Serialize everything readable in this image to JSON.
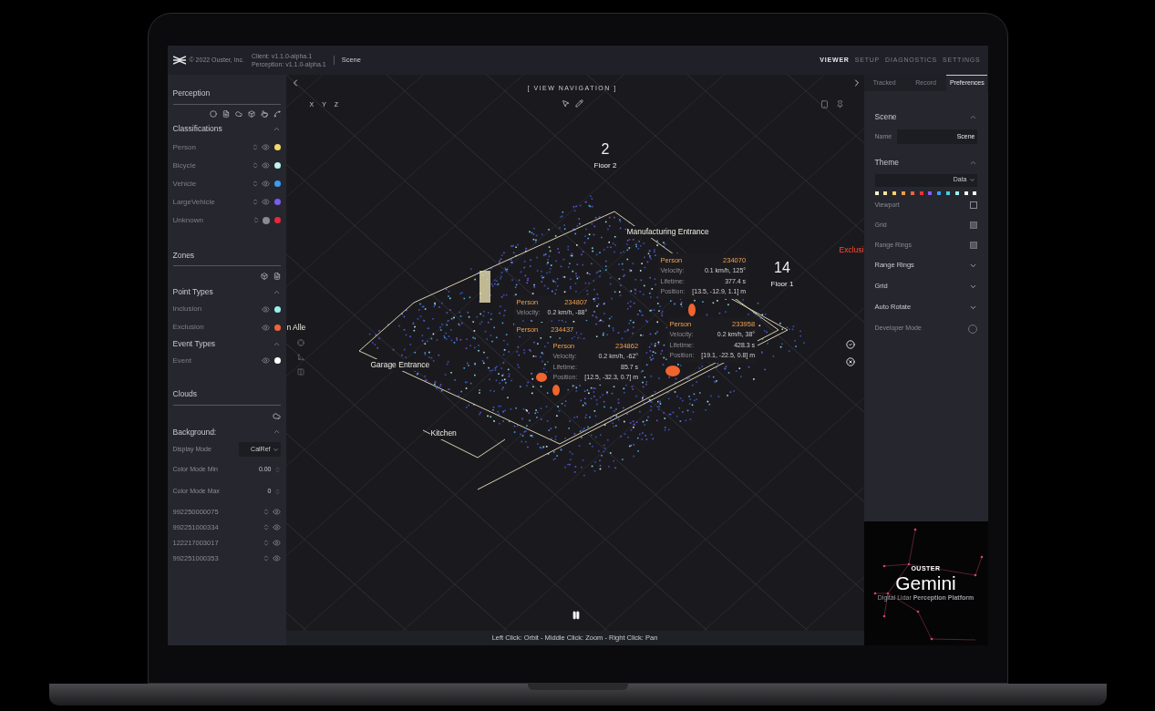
{
  "header": {
    "copyright": "© 2022 Ouster, Inc.",
    "versions": [
      "Client: v1.1.0-alpha.1",
      "Perception: v1.1.0-alpha.1"
    ],
    "page": "Scene",
    "nav": [
      {
        "label": "VIEWER",
        "selected": true
      },
      {
        "label": "SETUP",
        "selected": false
      },
      {
        "label": "DIAGNOSTICS",
        "selected": false
      },
      {
        "label": "SETTINGS",
        "selected": false
      }
    ]
  },
  "left_panel": {
    "perception": {
      "title": "Perception"
    },
    "classifications": {
      "title": "Classifications",
      "items": [
        {
          "label": "Person",
          "visible": true,
          "color": "#f5d76e"
        },
        {
          "label": "Bicycle",
          "visible": true,
          "color": "#bff5f0"
        },
        {
          "label": "Vehicle",
          "visible": true,
          "color": "#3b9cf0"
        },
        {
          "label": "LargeVehicle",
          "visible": true,
          "color": "#7a5cf0"
        },
        {
          "label": "Unknown",
          "visible": false,
          "color": "#e8283c"
        }
      ]
    },
    "zones": {
      "title": "Zones"
    },
    "point_types": {
      "title": "Point Types",
      "items": [
        {
          "label": "Inclusion",
          "visible": true,
          "color": "#9af0ec"
        },
        {
          "label": "Exclusion",
          "visible": true,
          "color": "#f0643a"
        }
      ]
    },
    "event_types": {
      "title": "Event Types",
      "items": [
        {
          "label": "Event",
          "visible": true,
          "color": "#ffffff"
        }
      ]
    },
    "clouds": {
      "title": "Clouds"
    },
    "background": {
      "title": "Background:",
      "display_mode": {
        "label": "Display Mode",
        "value": "CalRef"
      },
      "color_min": {
        "label": "Color Mode Min",
        "value": "0.00"
      },
      "color_max": {
        "label": "Color Mode Max",
        "value": "0"
      }
    },
    "sensors": [
      {
        "serial": "992250000075",
        "visible": true
      },
      {
        "serial": "992251000334",
        "visible": true
      },
      {
        "serial": "122217003017",
        "visible": true
      },
      {
        "serial": "992251000353",
        "visible": true
      }
    ]
  },
  "viewport": {
    "nav_title": "[ VIEW NAVIGATION ]",
    "axes": [
      "X",
      "Y",
      "Z"
    ],
    "floors": [
      {
        "number": "2",
        "label": "Floor 2"
      },
      {
        "number": "14",
        "label": "Floor 1"
      }
    ],
    "zone_labels": [
      {
        "text": "Manufacturing Entrance",
        "kind": "inclusion"
      },
      {
        "text": "Garage Entrance",
        "kind": "inclusion"
      },
      {
        "text": "Kitchen",
        "kind": "inclusion"
      },
      {
        "text": "n Alle",
        "kind": "inclusion"
      },
      {
        "text": "Exclusi",
        "kind": "exclusion"
      }
    ],
    "tracks": [
      {
        "class": "Person",
        "id": "234807",
        "fields": [
          {
            "label": "Velocity:",
            "value": "0.2 km/h, -88°"
          }
        ]
      },
      {
        "class": "Person",
        "id": "234437"
      },
      {
        "class": "Person",
        "id": "234862",
        "fields": [
          {
            "label": "Velocity:",
            "value": "0.2 km/h, -62°"
          },
          {
            "label": "Lifetime:",
            "value": "85.7 s"
          },
          {
            "label": "Position:",
            "value": "[12.5, -32.3, 0.7] m"
          }
        ]
      },
      {
        "class": "Person",
        "id": "234070",
        "fields": [
          {
            "label": "Velocity:",
            "value": "0.1 km/h, 125°"
          },
          {
            "label": "Lifetime:",
            "value": "377.4 s"
          },
          {
            "label": "Position:",
            "value": "[13.5, -12.9, 1.1] m"
          }
        ]
      },
      {
        "class": "Person",
        "id": "233958",
        "fields": [
          {
            "label": "Velocity:",
            "value": "0.2 km/h, 38°"
          },
          {
            "label": "Lifetime:",
            "value": "428.3 s"
          },
          {
            "label": "Position:",
            "value": "[19.1, -22.5, 0.8] m"
          }
        ]
      }
    ],
    "hint": "Left Click: Orbit - Middle Click: Zoom - Right Click: Pan"
  },
  "right_panel": {
    "tabs": [
      {
        "label": "Tracked",
        "selected": false
      },
      {
        "label": "Record",
        "selected": false
      },
      {
        "label": "Preferences",
        "selected": true
      }
    ],
    "scene": {
      "title": "Scene",
      "name_label": "Name",
      "name_value": "Scene"
    },
    "theme": {
      "title": "Theme",
      "value": "Data",
      "swatches": [
        {
          "color": "#f5f0d0"
        },
        {
          "color": "#f5e6a0"
        },
        {
          "color": "#f2d36a"
        },
        {
          "color": "#f29a4a"
        },
        {
          "color": "#f0643a"
        },
        {
          "color": "#e8323c"
        },
        {
          "color": "#8a5cf0"
        },
        {
          "color": "#3b9cf0"
        },
        {
          "color": "#3fd0e0"
        },
        {
          "color": "#a0f0f0"
        },
        {
          "color": "#f4f4f4"
        },
        {
          "color": "#fafafa"
        }
      ],
      "toggles": [
        {
          "label": "Viewport",
          "checked": false
        },
        {
          "label": "Grid",
          "checked": true
        },
        {
          "label": "Range Rings",
          "checked": true
        }
      ]
    },
    "sections": [
      {
        "title": "Range Rings",
        "expanded": false
      },
      {
        "title": "Grid",
        "expanded": false
      },
      {
        "title": "Auto Rotate",
        "expanded": false
      }
    ],
    "developer_mode": {
      "label": "Developer Mode",
      "on": false
    }
  },
  "promo": {
    "brand": "OUSTER",
    "title": "Gemini",
    "subtitle": "Digital Lidar **Perception Platform**"
  }
}
